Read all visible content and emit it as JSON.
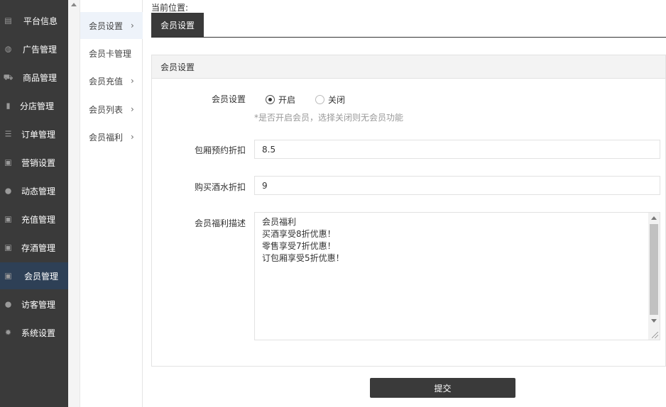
{
  "sidebar": {
    "items": [
      {
        "label": "平台信息",
        "icon": "newspaper-icon"
      },
      {
        "label": "广告管理",
        "icon": "globe-icon"
      },
      {
        "label": "商品管理",
        "icon": "cart-icon"
      },
      {
        "label": "分店管理",
        "icon": "book-icon"
      },
      {
        "label": "订单管理",
        "icon": "list-icon"
      },
      {
        "label": "营销设置",
        "icon": "gift-icon"
      },
      {
        "label": "动态管理",
        "icon": "user-icon"
      },
      {
        "label": "充值管理",
        "icon": "gift-icon"
      },
      {
        "label": "存酒管理",
        "icon": "gift-icon"
      },
      {
        "label": "会员管理",
        "icon": "gift-icon"
      },
      {
        "label": "访客管理",
        "icon": "user-icon"
      },
      {
        "label": "系统设置",
        "icon": "gear-icon"
      }
    ],
    "active_index": 9
  },
  "submenu": {
    "items": [
      {
        "label": "会员设置",
        "arrow": "›"
      },
      {
        "label": "会员卡管理",
        "arrow": ""
      },
      {
        "label": "会员充值",
        "arrow": "›"
      },
      {
        "label": "会员列表",
        "arrow": "›"
      },
      {
        "label": "会员福利",
        "arrow": "›"
      }
    ],
    "active_index": 0
  },
  "breadcrumb": {
    "label": "当前位置:",
    "current": "会员设置"
  },
  "panel": {
    "title": "会员设置"
  },
  "form": {
    "member_setting": {
      "label": "会员设置",
      "option_on": "开启",
      "option_off": "关闭",
      "selected": "开启",
      "hint": "*是否开启会员，选择关闭则无会员功能"
    },
    "room_discount": {
      "label": "包厢预约折扣",
      "value": "8.5"
    },
    "drink_discount": {
      "label": "购买酒水折扣",
      "value": "9"
    },
    "benefit_desc": {
      "label": "会员福利描述",
      "value": "会员福利\n买酒享受8折优惠！\n零售享受7折优惠！\n订包厢享受5折优惠！"
    },
    "submit_label": "提交"
  }
}
